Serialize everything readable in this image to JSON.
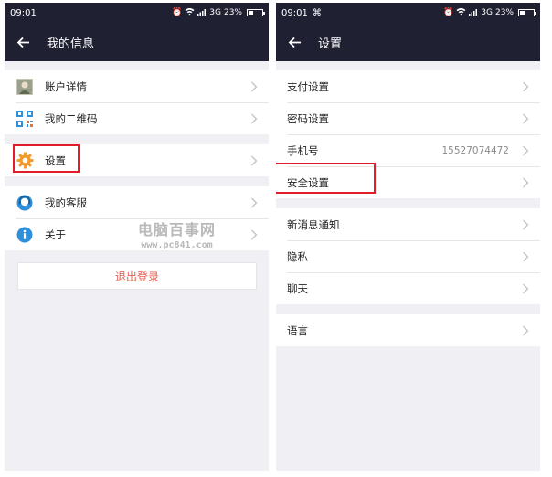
{
  "left_screen": {
    "status": {
      "time": "09:01",
      "network": "3G",
      "battery": "23%"
    },
    "title": "我的信息",
    "groups": [
      [
        {
          "label": "账户详情",
          "icon": "avatar-photo-icon"
        },
        {
          "label": "我的二维码",
          "icon": "qr-code-icon"
        }
      ],
      [
        {
          "label": "设置",
          "icon": "gear-icon",
          "highlighted": true
        }
      ],
      [
        {
          "label": "我的客服",
          "icon": "customer-service-icon"
        },
        {
          "label": "关于",
          "icon": "info-icon"
        }
      ]
    ],
    "logout_label": "退出登录",
    "watermark": {
      "title": "电脑百事网",
      "url": "www.pc841.com"
    }
  },
  "right_screen": {
    "status": {
      "time": "09:01",
      "network": "3G",
      "battery": "23%"
    },
    "title": "设置",
    "groups": [
      [
        {
          "label": "支付设置"
        },
        {
          "label": "密码设置"
        },
        {
          "label": "手机号",
          "value": "15527074472"
        },
        {
          "label": "安全设置",
          "highlighted": true
        }
      ],
      [
        {
          "label": "新消息通知"
        },
        {
          "label": "隐私"
        },
        {
          "label": "聊天"
        }
      ],
      [
        {
          "label": "语言"
        }
      ]
    ]
  },
  "colors": {
    "header_bg": "#1f2133",
    "page_bg": "#efeff4",
    "highlight_border": "#e11d2a",
    "logout_text": "#e85a4f"
  }
}
